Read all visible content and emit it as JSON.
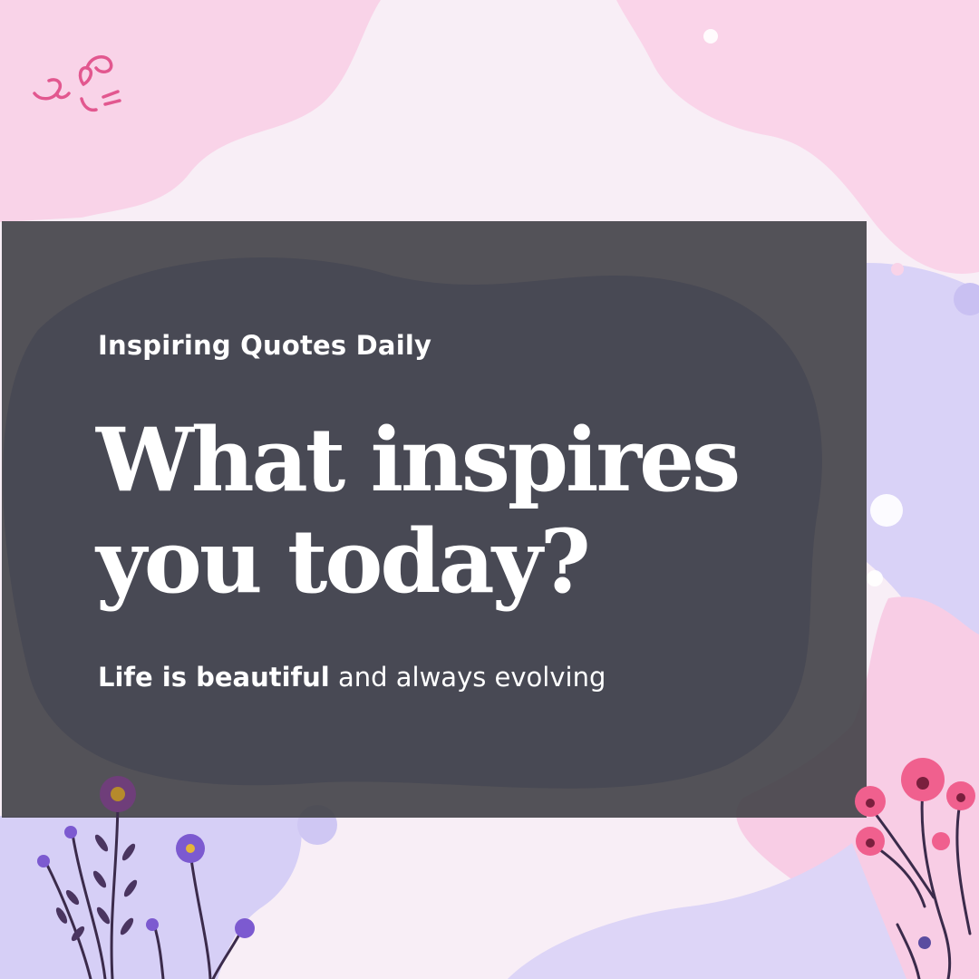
{
  "eyebrow": "Inspiring Quotes Daily",
  "headline": {
    "line1": "What inspires",
    "line2": "you today?"
  },
  "tagline": {
    "bold": "Life is beautiful",
    "rest": " and always evolving"
  },
  "colors": {
    "pink_blob": "#f9d6ea",
    "lavender_blob": "#d8d0f7",
    "panel": "#444448",
    "flower_pink": "#f0608e",
    "flower_purple": "#8a5bd0",
    "stem": "#3b2b4b"
  },
  "icons": [
    "doodle-icon",
    "flower-illustration-left",
    "flower-illustration-right"
  ]
}
